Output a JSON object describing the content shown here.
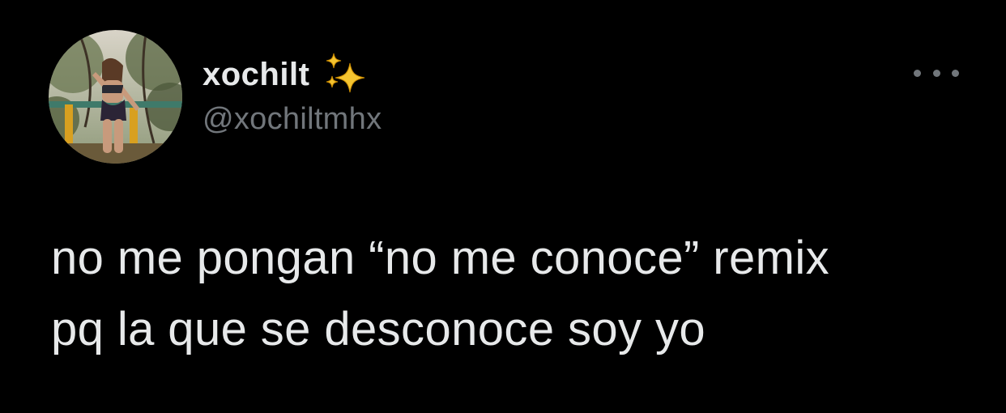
{
  "tweet": {
    "author": {
      "display_name": "xochilt",
      "emoji": "sparkles-icon",
      "handle": "@xochiltmhx",
      "avatar": "avatar-photo"
    },
    "menu_icon": "more-horizontal-icon",
    "text_lines": [
      "no me pongan “no me conoce” remix",
      "pq la que se desconoce soy yo"
    ]
  },
  "colors": {
    "background": "#000000",
    "primary_text": "#e7e9ea",
    "secondary_text": "#71767b",
    "sparkle": "#f4c430"
  }
}
